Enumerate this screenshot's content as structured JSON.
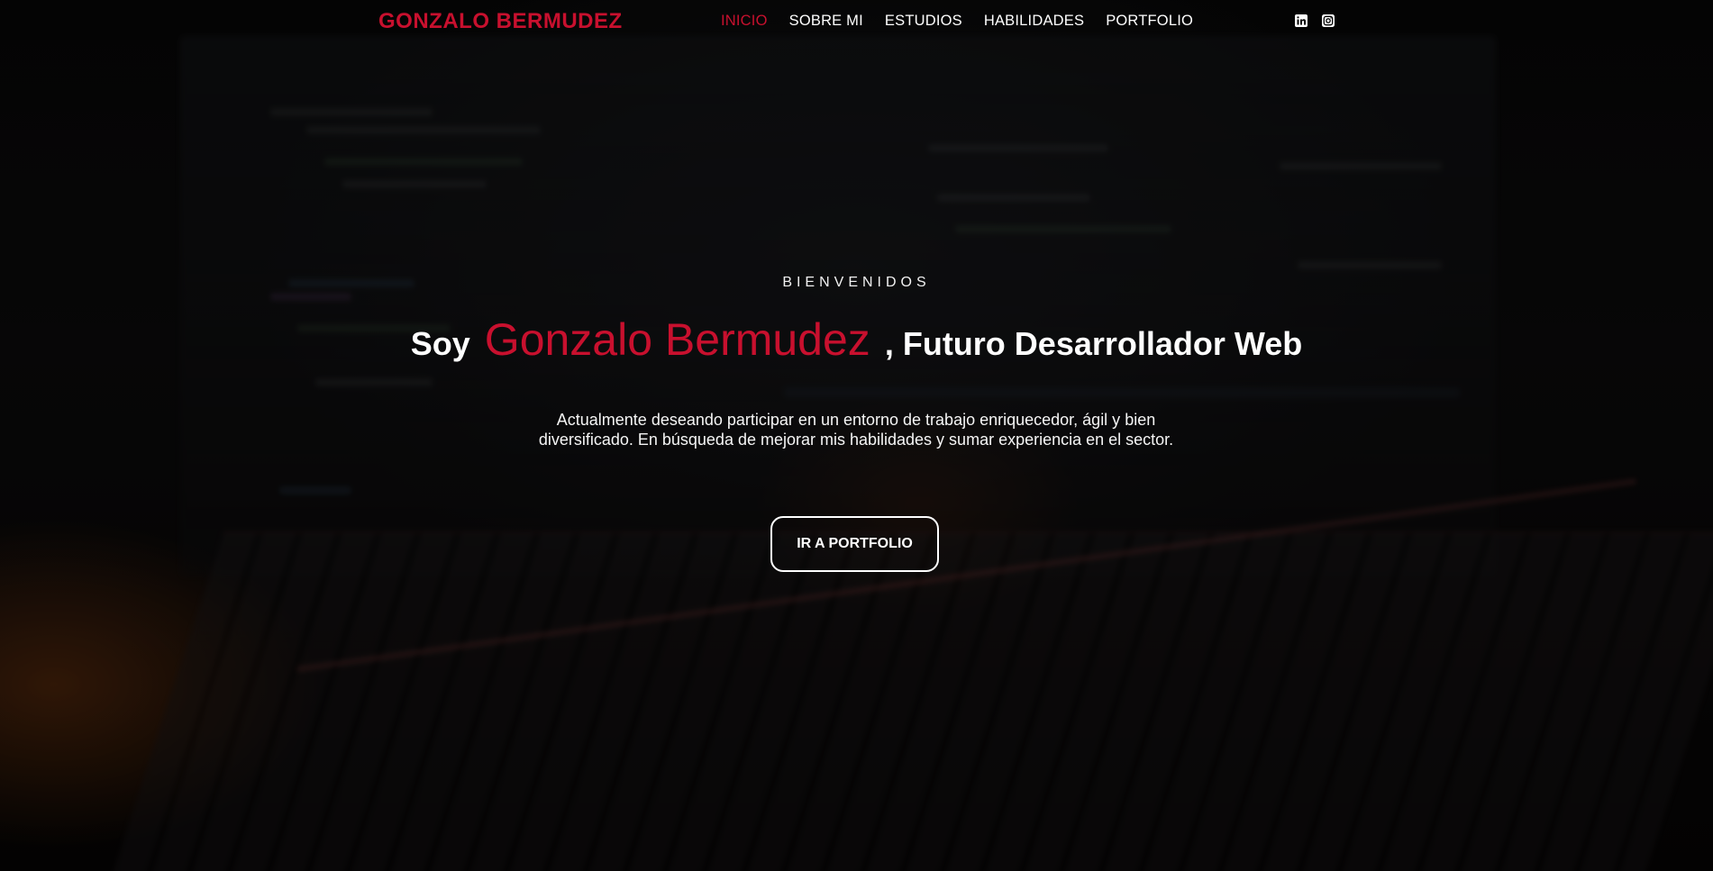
{
  "header": {
    "brand": "GONZALO BERMUDEZ",
    "nav": [
      {
        "label": "INICIO",
        "active": true
      },
      {
        "label": "SOBRE MI",
        "active": false
      },
      {
        "label": "ESTUDIOS",
        "active": false
      },
      {
        "label": "HABILIDADES",
        "active": false
      },
      {
        "label": "PORTFOLIO",
        "active": false
      }
    ],
    "social_icons": [
      "linkedin-icon",
      "instagram-icon"
    ]
  },
  "hero": {
    "eyebrow": "BIENVENIDOS",
    "headline_prefix": "Soy",
    "headline_name": "Gonzalo Bermudez",
    "headline_suffix": ", Futuro Desarrollador Web",
    "description": "Actualmente deseando participar en un entorno de trabajo enriquecedor, ágil y bien diversificado. En búsqueda de mejorar mis habilidades y sumar experiencia en el sector.",
    "cta_label": "IR A PORTFOLIO"
  },
  "colors": {
    "accent": "#c8102e",
    "text": "#ffffff",
    "background": "#050505"
  }
}
